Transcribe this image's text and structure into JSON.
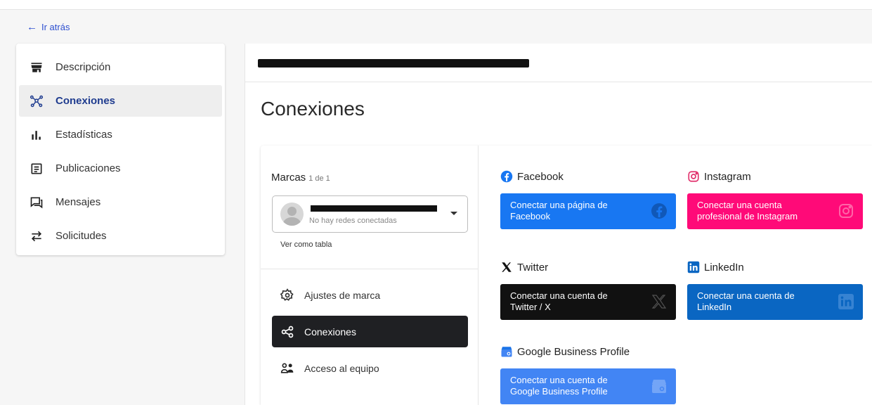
{
  "nav": {
    "back_label": "Ir atrás"
  },
  "sidebar": {
    "items": [
      {
        "label": "Descripción",
        "icon": "storefront-icon"
      },
      {
        "label": "Conexiones",
        "icon": "network-icon"
      },
      {
        "label": "Estadísticas",
        "icon": "bar-chart-icon"
      },
      {
        "label": "Publicaciones",
        "icon": "article-icon"
      },
      {
        "label": "Mensajes",
        "icon": "chat-icon"
      },
      {
        "label": "Solicitudes",
        "icon": "swap-icon"
      }
    ]
  },
  "header": {
    "page_title": "Conexiones"
  },
  "brands": {
    "title": "Marcas",
    "count": "1 de 1",
    "selected_sub": "No hay redes conectadas",
    "view_table": "Ver como tabla"
  },
  "brand_menu": [
    {
      "label": "Ajustes de marca",
      "icon": "gear-icon"
    },
    {
      "label": "Conexiones",
      "icon": "share-icon"
    },
    {
      "label": "Acceso al equipo",
      "icon": "team-icon"
    }
  ],
  "networks": {
    "facebook": {
      "name": "Facebook",
      "button": "Conectar una página de Facebook",
      "color": "#1877f2"
    },
    "instagram": {
      "name": "Instagram",
      "button": "Conectar una cuenta profesional de Instagram",
      "color": "#ff0a78"
    },
    "twitter": {
      "name": "Twitter",
      "button": "Conectar una cuenta de Twitter / X",
      "color": "#111111"
    },
    "linkedin": {
      "name": "LinkedIn",
      "button": "Conectar una cuenta de LinkedIn",
      "color": "#0a66c2"
    },
    "google": {
      "name": "Google Business Profile",
      "button": "Conectar una cuenta de Google Business Profile",
      "color": "#4285f4"
    }
  },
  "colors": {
    "accent": "#2d4fd0",
    "active_menu": "#1f2023"
  }
}
